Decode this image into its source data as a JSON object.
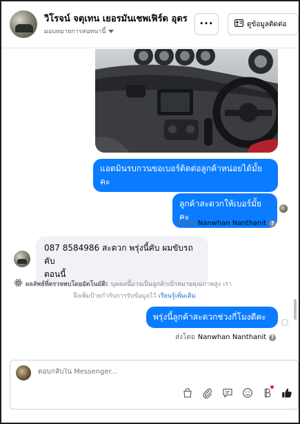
{
  "header": {
    "title": "วิโรจน์ จตุเทน เยอรมันเชพเฟิร์ด อุดร",
    "subtitle": "มอบหมายการสนทนานี้",
    "more_label": "•••",
    "contact_button_label": "ดูข้อมูลติดต่อ"
  },
  "messages": {
    "out1_line1": "แอดมินรบกวนขอเบอร์ติดต่อลูกค้าหน่อยได้มั้ย",
    "out1_line2": "คะ",
    "out2": "ลูกค้าสะดวกให้เบอร์มั้ยคะ",
    "sent_by_label_1": "ส่งโดย",
    "sent_by_name_1": "Nanwhan Nanthanit",
    "in1_line1": "087 8584986 สะดวก พรุ่งนี้คับ ผมขับรถคับ",
    "in1_line2": "ตอนนี้",
    "out3": "พรุ่งนี้ลูกค้าสะดวกช่วงกี่โมงดีคะ",
    "sent_by_label_2": "ส่งโดย",
    "sent_by_name_2": "Nanwhan Nanthanit"
  },
  "auto_note": {
    "heading": "ผลลัพธ์ที่ตรวจพบโดยอัตโนมัติ:",
    "text1": "บุคคลนี้อาจเป็นลูกค้าเป้าหมายคุณภาพสูง เรา",
    "text2": "จึงเพิ่มป้ายกำกับการรับข้อมูลไว้",
    "link": "เรียนรู้เพิ่มเติม"
  },
  "composer": {
    "placeholder": "ตอบกลับใน Messenger..."
  },
  "icons": {
    "more": "more-icon",
    "contact": "contact-card-icon",
    "help": "help-icon",
    "auto": "atom-icon",
    "shop": "shopping-bag-icon",
    "attach": "paperclip-icon",
    "saved_reply": "saved-reply-icon",
    "emoji": "emoji-icon",
    "payment": "payment-icon",
    "like": "thumbs-up-icon"
  },
  "colors": {
    "outgoing_bubble": "#0a7cff",
    "incoming_bubble": "#f0f2f5",
    "link": "#216fdb",
    "badge": "#e41e3f"
  }
}
